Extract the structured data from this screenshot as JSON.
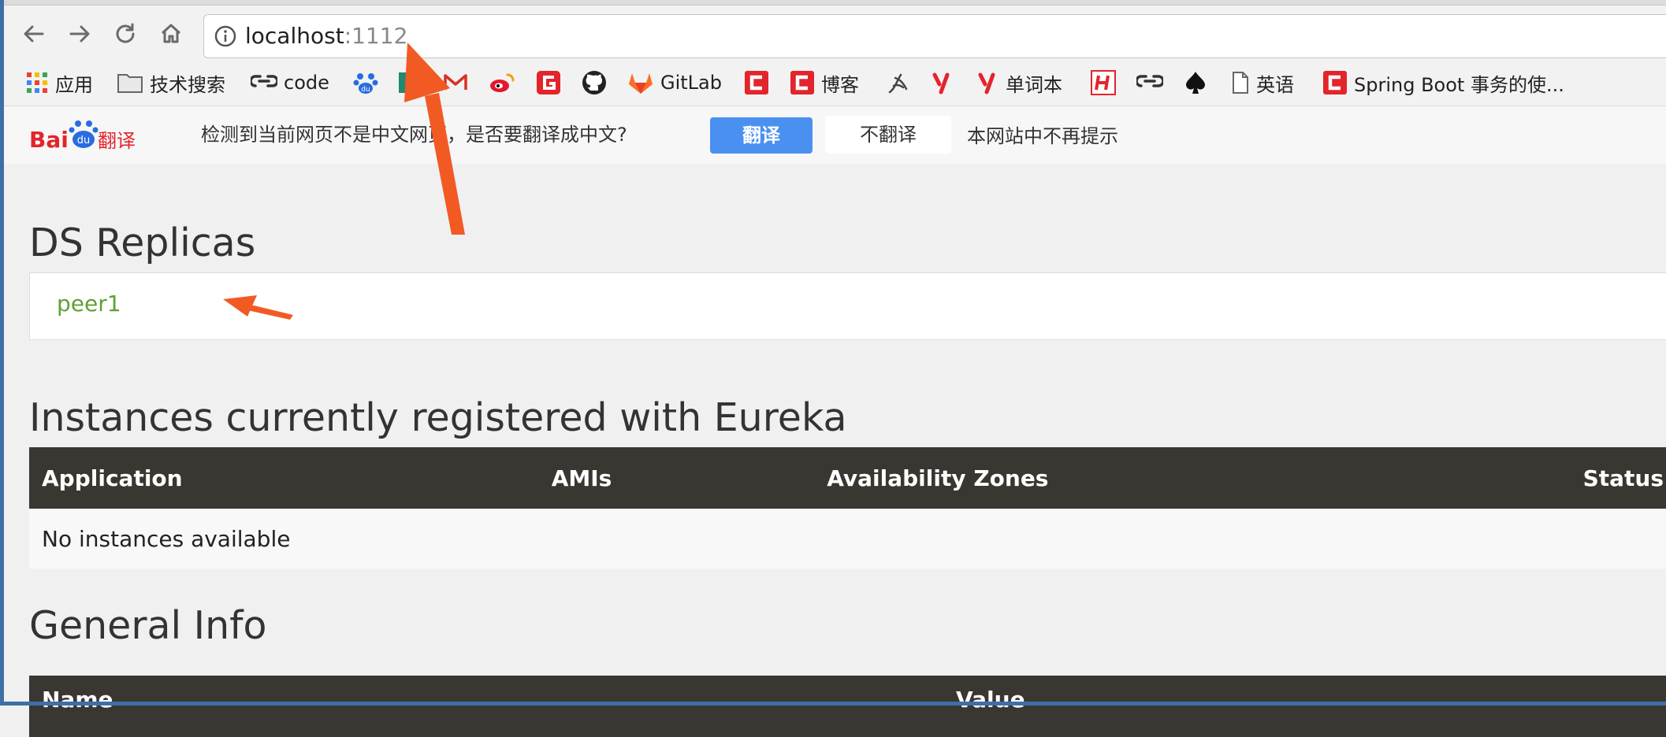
{
  "browser": {
    "url_host": "localhost",
    "url_port": ":1112"
  },
  "bookmarks": [
    {
      "label": "应用",
      "icon": "apps-grid-icon"
    },
    {
      "label": "技术搜索",
      "icon": "folder-icon"
    },
    {
      "label": "code",
      "icon": "link-chain-icon"
    },
    {
      "label": "",
      "icon": "baidu-paw-icon"
    },
    {
      "label": "",
      "icon": "green-square-icon"
    },
    {
      "label": "",
      "icon": "gmail-icon"
    },
    {
      "label": "",
      "icon": "weibo-icon"
    },
    {
      "label": "",
      "icon": "red-g-icon"
    },
    {
      "label": "",
      "icon": "github-icon"
    },
    {
      "label": "GitLab",
      "icon": "gitlab-icon"
    },
    {
      "label": "",
      "icon": "csdn-icon"
    },
    {
      "label": "博客",
      "icon": "csdn-icon"
    },
    {
      "label": "",
      "icon": "script-icon"
    },
    {
      "label": "",
      "icon": "youdao-icon"
    },
    {
      "label": "单词本",
      "icon": "youdao-icon"
    },
    {
      "label": "",
      "icon": "h-icon"
    },
    {
      "label": "",
      "icon": "link-chain-icon"
    },
    {
      "label": "",
      "icon": "spade-icon"
    },
    {
      "label": "英语",
      "icon": "page-icon"
    },
    {
      "label": "Spring Boot 事务的使...",
      "icon": "csdn-icon"
    }
  ],
  "translate_bar": {
    "logo": "Bai du 翻译",
    "message": "检测到当前网页不是中文网页，是否要翻译成中文?",
    "translate_label": "翻译",
    "no_translate_label": "不翻译",
    "never_label": "本网站中不再提示"
  },
  "page": {
    "replicas_title": "DS Replicas",
    "replica_link": "peer1",
    "instances_title": "Instances currently registered with Eureka",
    "instances_headers": [
      "Application",
      "AMIs",
      "Availability Zones",
      "Status"
    ],
    "instances_empty": "No instances available",
    "general_title": "General Info",
    "general_headers": [
      "Name",
      "Value"
    ]
  },
  "colors": {
    "accent_link": "#5fa134",
    "table_header": "#3a3632",
    "translate_button": "#4a90f0",
    "annotation_arrow": "#f25a24"
  }
}
